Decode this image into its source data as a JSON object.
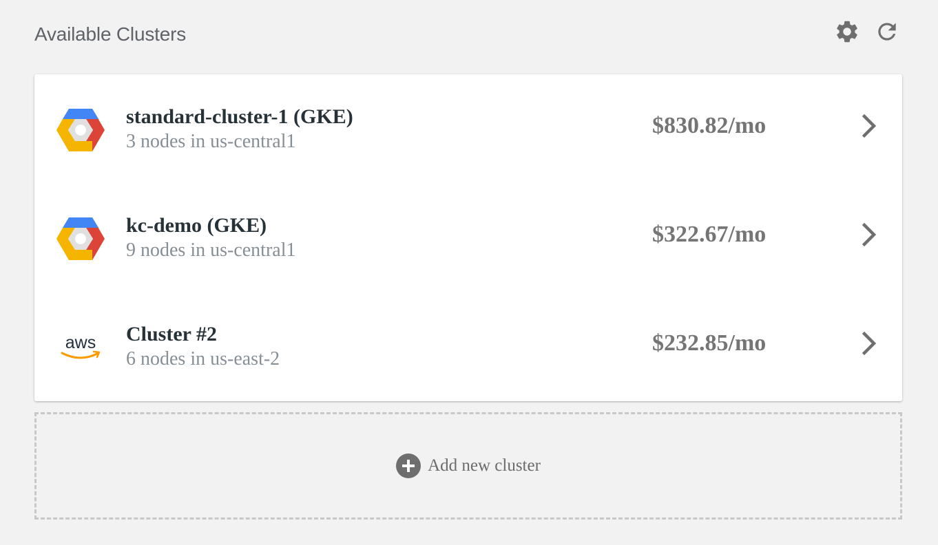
{
  "header": {
    "title": "Available Clusters",
    "settings_icon": "gear-icon",
    "refresh_icon": "refresh-icon"
  },
  "clusters": [
    {
      "name": "standard-cluster-1 (GKE)",
      "subtitle": "3 nodes in us-central1",
      "cost": "$830.82/mo",
      "provider_icon": "gke-icon"
    },
    {
      "name": "kc-demo (GKE)",
      "subtitle": "9 nodes in us-central1",
      "cost": "$322.67/mo",
      "provider_icon": "gke-icon"
    },
    {
      "name": "Cluster #2",
      "subtitle": "6 nodes in us-east-2",
      "cost": "$232.85/mo",
      "provider_icon": "aws-logo",
      "provider_logo_text": "aws"
    }
  ],
  "add_cluster": {
    "label": "Add new cluster",
    "icon": "plus-circle-icon"
  },
  "colors": {
    "background": "#f2f2f2",
    "gke_blue": "#4285f4",
    "gke_red": "#db4437",
    "gke_yellow": "#f4b400",
    "aws_orange": "#ff9900",
    "icon_gray": "#6e6e6e"
  }
}
